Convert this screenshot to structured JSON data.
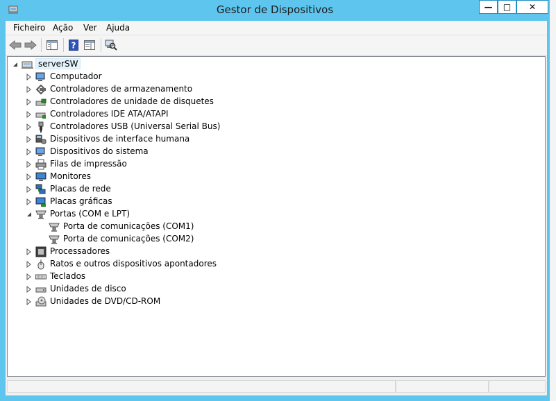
{
  "window": {
    "title": "Gestor de Dispositivos",
    "controls": {
      "minimize": "—",
      "maximize": "□",
      "close": "✕"
    }
  },
  "menubar": {
    "items": [
      "Ficheiro",
      "Ação",
      "Ver",
      "Ajuda"
    ]
  },
  "toolbar": {
    "buttons": [
      "back-arrow-icon",
      "forward-arrow-icon",
      "show-hide-console-tree-icon",
      "help-icon",
      "properties-icon",
      "scan-hardware-icon"
    ]
  },
  "tree": {
    "root": "serverSW",
    "categories": [
      "Computador",
      "Controladores de armazenamento",
      "Controladores de unidade de disquetes",
      "Controladores IDE ATA/ATAPI",
      "Controladores USB (Universal Serial Bus)",
      "Dispositivos de interface humana",
      "Dispositivos do sistema",
      "Filas de impressão",
      "Monitores",
      "Placas de rede",
      "Placas gráficas",
      "Portas (COM e LPT)",
      "Processadores",
      "Ratos e outros dispositivos apontadores",
      "Teclados",
      "Unidades de disco",
      "Unidades de DVD/CD-ROM"
    ],
    "ports_children": [
      "Porta de comunicações (COM1)",
      "Porta de comunicações (COM2)"
    ]
  },
  "colors": {
    "title_bar": "#5ec6ee",
    "selection": "#e5f3fb",
    "tree_bg": "#ffffff"
  }
}
